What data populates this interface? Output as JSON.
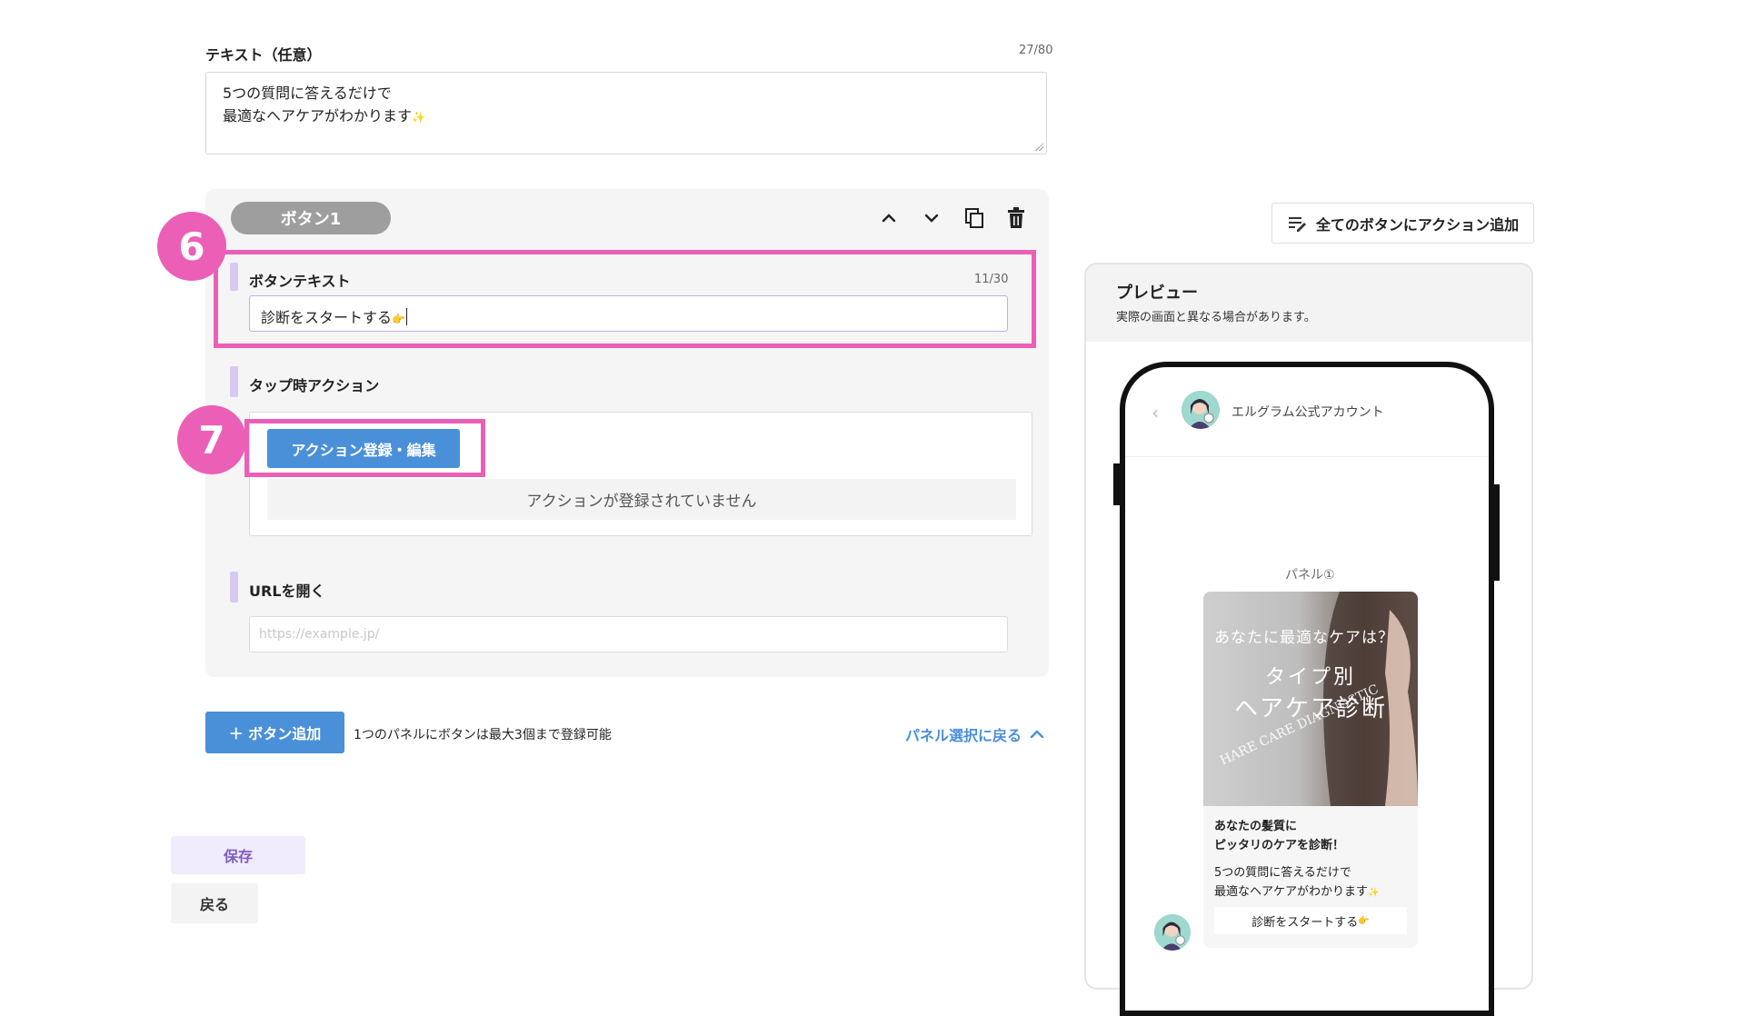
{
  "text_field": {
    "label": "テキスト（任意）",
    "counter": "27/80",
    "line1": "5つの質問に答えるだけで",
    "line2": "最適なヘアケアがわかります",
    "sparkle": "✨"
  },
  "button_card": {
    "pill_label": "ボタン1",
    "button_text_label": "ボタンテキスト",
    "button_text_counter": "11/30",
    "button_text_value": "診断をスタートする",
    "button_text_emoji": "👉",
    "tap_action_label": "タップ時アクション",
    "action_button_label": "アクション登録・編集",
    "no_action_text": "アクションが登録されていません",
    "url_label": "URLを開く",
    "url_placeholder": "https://example.jp/"
  },
  "annotations": {
    "marker6": "6",
    "marker7": "7"
  },
  "add_button": {
    "label": "＋ ボタン追加",
    "note": "1つのパネルにボタンは最大3個まで登録可能",
    "back_to_panels": "パネル選択に戻る"
  },
  "footer": {
    "save": "保存",
    "back": "戻る"
  },
  "add_action_all": "全てのボタンにアクション追加",
  "preview": {
    "title": "プレビュー",
    "note": "実際の画面と異なる場合があります。",
    "account_name": "エルグラム公式アカウント",
    "panel_label": "パネル①",
    "image_line1": "あなたに最適なケアは？",
    "image_line2": "タイプ別",
    "image_line3": "ヘアケア診断",
    "image_line4": "HARE CARE DIAGNOSTIC",
    "card_title1": "あなたの髪質に",
    "card_title2": "ピッタリのケアを診断！",
    "card_text1": "5つの質問に答えるだけで",
    "card_text2": "最適なヘアケアがわかります",
    "card_sparkle": "✨",
    "card_button": "診断をスタートする",
    "card_button_emoji": "👉"
  },
  "colors": {
    "highlight": "#ec5fb6",
    "primary": "#4a90d9",
    "label_bar": "#d7c8f4",
    "save_bg": "#f1ecfb",
    "save_text": "#7c5cc4"
  }
}
